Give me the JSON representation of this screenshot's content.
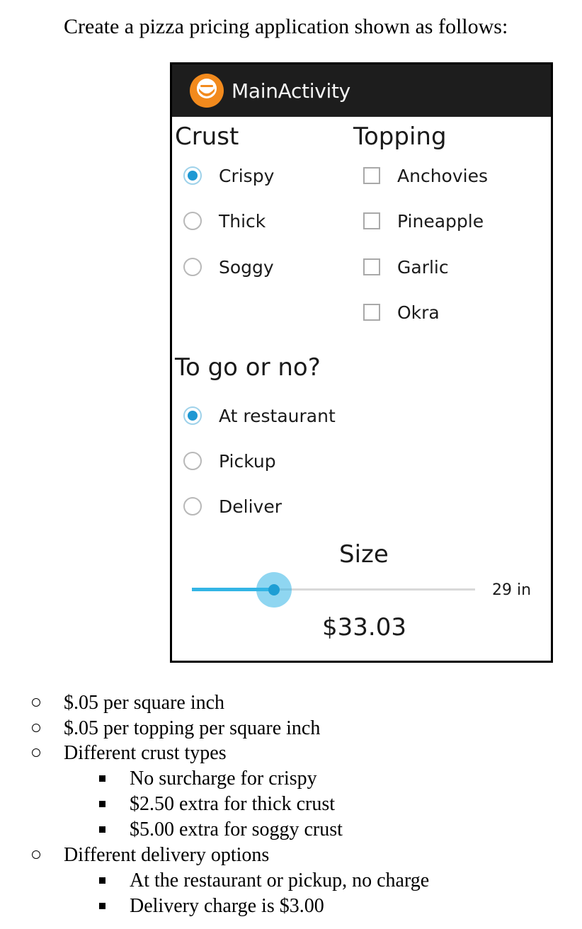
{
  "document": {
    "title": "Create a pizza pricing application shown as follows:"
  },
  "app": {
    "title": "MainActivity",
    "crust": {
      "heading": "Crust",
      "options": [
        {
          "label": "Crispy",
          "checked": true
        },
        {
          "label": "Thick",
          "checked": false
        },
        {
          "label": "Soggy",
          "checked": false
        }
      ]
    },
    "topping": {
      "heading": "Topping",
      "options": [
        {
          "label": "Anchovies",
          "checked": false
        },
        {
          "label": "Pineapple",
          "checked": false
        },
        {
          "label": "Garlic",
          "checked": false
        },
        {
          "label": "Okra",
          "checked": false
        }
      ]
    },
    "togo": {
      "heading": "To go or no?",
      "options": [
        {
          "label": "At restaurant",
          "checked": true
        },
        {
          "label": "Pickup",
          "checked": false
        },
        {
          "label": "Deliver",
          "checked": false
        }
      ]
    },
    "size": {
      "heading": "Size",
      "value_text": "29 in",
      "slider_fraction": 0.29
    },
    "price": "$33.03"
  },
  "notes": {
    "items": [
      {
        "text": "$.05 per square inch"
      },
      {
        "text": "$.05 per topping per square inch"
      },
      {
        "text": "Different crust types"
      },
      {
        "text": "No surcharge for crispy"
      },
      {
        "text": "$2.50 extra for thick crust"
      },
      {
        "text": "$5.00 extra for soggy crust"
      },
      {
        "text": "Different delivery options"
      },
      {
        "text": "At the restaurant or pickup, no charge"
      },
      {
        "text": "Delivery charge is $3.00"
      }
    ]
  },
  "colors": {
    "action_bar": "#1d1d1d",
    "holo_blue": "#33b5e5",
    "radio_checked": "#1f98d3",
    "icon_orange": "#f28a1d"
  }
}
